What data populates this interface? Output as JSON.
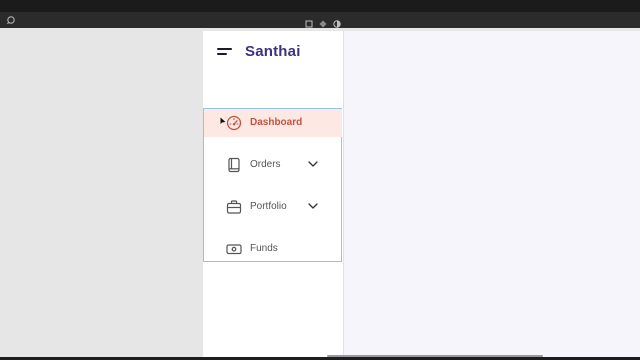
{
  "app": {
    "brand": "Santhai"
  },
  "sidebar": {
    "items": [
      {
        "label": "Dashboard",
        "icon": "speedometer-icon",
        "active": true,
        "expandable": false
      },
      {
        "label": "Orders",
        "icon": "book-icon",
        "active": false,
        "expandable": true
      },
      {
        "label": "Portfolio",
        "icon": "briefcase-icon",
        "active": false,
        "expandable": true
      },
      {
        "label": "Funds",
        "icon": "banknote-icon",
        "active": false,
        "expandable": false
      }
    ]
  },
  "colors": {
    "brand": "#3e327f",
    "active_text": "#c0553f",
    "active_bg": "#fde8e3",
    "selection_border": "#8ec5e8"
  }
}
